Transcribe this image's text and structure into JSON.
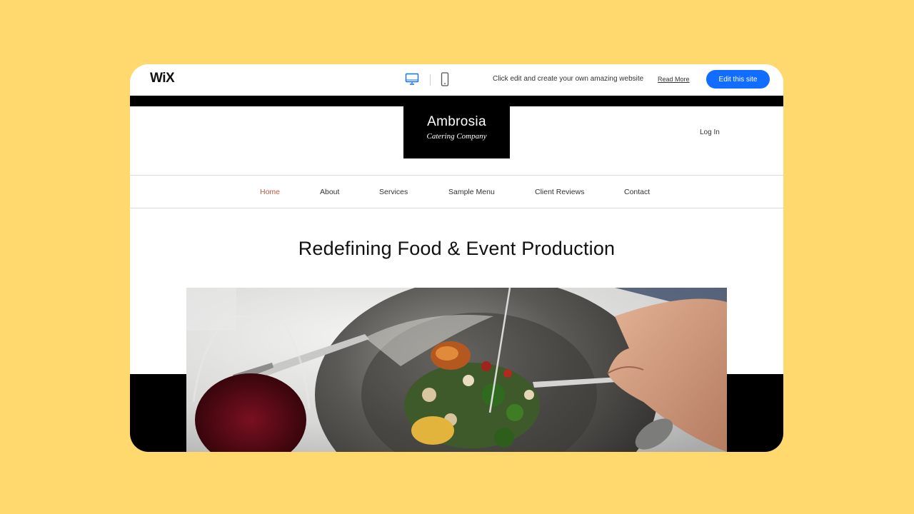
{
  "wixbar": {
    "logo": "WiX",
    "devices": [
      "desktop-icon",
      "mobile-icon"
    ],
    "promo_text": "Click edit and create your own amazing website",
    "read_more": "Read More",
    "edit_button": "Edit this site",
    "accent": "#116DFF"
  },
  "site": {
    "logo_title": "Ambrosia",
    "logo_subtitle": "Catering Company",
    "login": "Log In",
    "nav": [
      {
        "label": "Home",
        "active": true
      },
      {
        "label": "About"
      },
      {
        "label": "Services"
      },
      {
        "label": "Sample Menu"
      },
      {
        "label": "Client Reviews"
      },
      {
        "label": "Contact"
      }
    ],
    "nav_active_color": "#C1593C",
    "hero_title": "Redefining Food & Event Production",
    "hero_image": "plated-dish-photo"
  },
  "background_color": "#FFD86E"
}
